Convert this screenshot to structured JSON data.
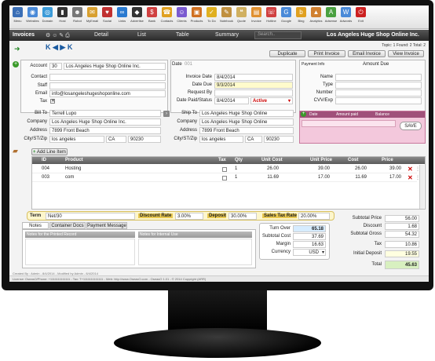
{
  "toolbar": {
    "items": [
      {
        "label": "Menu",
        "color": "#3b6fb6",
        "glyph": "⌂"
      },
      {
        "label": "Websites",
        "color": "#4a8ad8",
        "glyph": "◉"
      },
      {
        "label": "Domain",
        "color": "#3c9bd8",
        "glyph": "◎"
      },
      {
        "label": "Host",
        "color": "#333333",
        "glyph": "▮"
      },
      {
        "label": "Robot",
        "color": "#777777",
        "glyph": "☻"
      },
      {
        "label": "MyEmail",
        "color": "#d8a030",
        "glyph": "✉"
      },
      {
        "label": "Social",
        "color": "#c03030",
        "glyph": "♥"
      },
      {
        "label": "Links",
        "color": "#2a7ad0",
        "glyph": "∞"
      },
      {
        "label": "Advertise",
        "color": "#333333",
        "glyph": "◆"
      },
      {
        "label": "Bank",
        "color": "#d04040",
        "glyph": "$"
      },
      {
        "label": "Contacts",
        "color": "#e0a020",
        "glyph": "☎"
      },
      {
        "label": "Clients",
        "color": "#7a5ad0",
        "glyph": "☺"
      },
      {
        "label": "Products",
        "color": "#d07020",
        "glyph": "▣"
      },
      {
        "label": "To Do",
        "color": "#e0b020",
        "glyph": "✓"
      },
      {
        "label": "Notebook",
        "color": "#c09040",
        "glyph": "✎"
      },
      {
        "label": "Quote",
        "color": "#d0b060",
        "glyph": "❝"
      },
      {
        "label": "Invoice",
        "color": "#e09030",
        "glyph": "▤"
      },
      {
        "label": "Hotline",
        "color": "#d04040",
        "glyph": "☏"
      },
      {
        "label": "Google",
        "color": "#4a8ad8",
        "glyph": "G"
      },
      {
        "label": "Bing",
        "color": "#e0a020",
        "glyph": "b"
      },
      {
        "label": "Analytics",
        "color": "#d08030",
        "glyph": "▲"
      },
      {
        "label": "Adsense",
        "color": "#4aa040",
        "glyph": "A"
      },
      {
        "label": "Adwords",
        "color": "#4a8ad8",
        "glyph": "W"
      },
      {
        "label": "Exit",
        "color": "#cc2020",
        "glyph": "⏻"
      }
    ]
  },
  "nav": {
    "title": "Invoices",
    "tabs": [
      "Detail",
      "List",
      "Table",
      "Summary"
    ],
    "search_placeholder": "Search..",
    "record_title": "Los Angeles Huge Shop Online Inc."
  },
  "topic_info": "Topic: 1  Found: 2  Total: 2",
  "actions": {
    "duplicate": "Duplicate",
    "print": "Print Invoice",
    "email": "Email Invoice",
    "view": "View Invoice"
  },
  "date_label": "Date",
  "date_placeholder": "001",
  "payment_info": {
    "title": "Payment Info",
    "amount_due": "Amount Due",
    "name": "Name",
    "type": "Type",
    "number": "Number",
    "cvv": "CVV/Exp"
  },
  "account": {
    "account_label": "Account",
    "account_no": "30",
    "account_name": "Los Angeles Huge Shop Online Inc.",
    "contact_label": "Contact",
    "staff_label": "Staff",
    "email_label": "Email",
    "email": "info@losangeleshugeshoponline.com",
    "tax_label": "Tax"
  },
  "invoice_dates": {
    "invoice_date_label": "Invoice Date",
    "invoice_date": "8/4/2014",
    "date_due_label": "Date Due",
    "date_due": "9/3/2014",
    "request_by_label": "Request By",
    "date_paid_label": "Date Paid/Status",
    "date_paid": "8/4/2014",
    "status": "Active"
  },
  "bill_to": {
    "label": "Bill To",
    "name": "Terrell Lupo",
    "company_label": "Company",
    "company": "Los Angeles Huge Shop Online Inc.",
    "address_label": "Address",
    "address": "7899 Front Beach",
    "city_label": "City/ST/Zip",
    "city": "los angeles",
    "state": "CA",
    "zip": "90230"
  },
  "ship_to": {
    "label": "Ship To",
    "name": "Los Angeles Huge Shop Online",
    "company_label": "Company",
    "company": "Los Angeles Huge Shop Online",
    "address_label": "Address",
    "address": "7899 Front Beach",
    "city_label": "City/ST/Zip",
    "city": "los angeles",
    "state": "CA",
    "zip": "90230"
  },
  "payments": {
    "headers": [
      "Date",
      "Amount paid",
      "Balance"
    ],
    "save": "SAVE"
  },
  "line_items": {
    "add_label": "Add Line Item",
    "headers": [
      "ID",
      "Product",
      "Tax",
      "Qty",
      "Unit Cost",
      "Unit Price",
      "Cost",
      "Price"
    ],
    "rows": [
      {
        "id": "004",
        "product": "Hosting",
        "qty": "1",
        "unit_cost": "26.00",
        "unit_price": "39.00",
        "cost": "26.00",
        "price": "39.00"
      },
      {
        "id": "003",
        "product": "com",
        "qty": "1",
        "unit_cost": "11.69",
        "unit_price": "17.00",
        "cost": "11.69",
        "price": "17.00"
      }
    ]
  },
  "terms": {
    "term_label": "Term",
    "term": "Net/30",
    "discount_label": "Discount Rate",
    "discount": "3.00%",
    "deposit_label": "Deposit",
    "deposit": "30.00%",
    "sales_tax_label": "Sales Tax Rate",
    "sales_tax": "20.00%"
  },
  "notes": {
    "tabs": [
      "Notes",
      "Container Docs",
      "Payment Message"
    ],
    "printed": "Notes for the Printed Record",
    "internal": "Notes for Internal Use"
  },
  "turnover": {
    "turn_over_label": "Turn Over",
    "turn_over": "65.18",
    "subtotal_cost_label": "Subtotal Cost",
    "subtotal_cost": "37.69",
    "margin_label": "Margin",
    "margin": "16.63",
    "currency_label": "Currency",
    "currency": "USD"
  },
  "summary": {
    "subtotal_price_label": "Subtotal Price",
    "subtotal_price": "56.00",
    "discount_label": "Discount",
    "discount": "1.68",
    "subtotal_gross_label": "Subtotal Gross",
    "subtotal_gross": "54.32",
    "tax_label": "Tax",
    "tax": "10.86",
    "initial_deposit_label": "Initial Deposit",
    "initial_deposit": "19.55",
    "total_label": "Total",
    "total": "45.63"
  },
  "footer": {
    "created": "Created By : Admin - 8/4/2014 - Modified by Admin - 8/4/2014",
    "license": "License: OseasO/Phone: +1111111111111 - Tax: T+1111111111111 - Web: http://www.OseasO.com - OseasO 1.01 - © 2014 Copyright (ARR)"
  }
}
